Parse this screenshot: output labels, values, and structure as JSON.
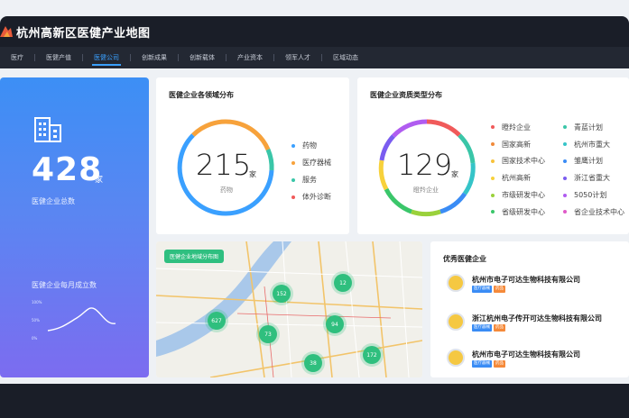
{
  "header": {
    "title": "杭州高新区医健产业地图"
  },
  "nav": [
    {
      "label": "医疗"
    },
    {
      "label": "医健产值"
    },
    {
      "label": "医健公司",
      "active": true
    },
    {
      "label": "创新成果"
    },
    {
      "label": "创新载体"
    },
    {
      "label": "产业资本"
    },
    {
      "label": "领军人才"
    },
    {
      "label": "区域动态"
    }
  ],
  "summary": {
    "total": "428",
    "unit": "家",
    "caption": "医健企业总数",
    "monthly_title": "医健企业每月成立数",
    "ticks": [
      "100%",
      "50%",
      "0%"
    ]
  },
  "field_dist": {
    "title": "医健企业各领域分布",
    "center_value": "215",
    "center_unit": "家",
    "center_label": "药物",
    "legend": [
      {
        "label": "药物",
        "color": "#3aa0ff"
      },
      {
        "label": "医疗器械",
        "color": "#f7a23b"
      },
      {
        "label": "服务",
        "color": "#3ac6a8"
      },
      {
        "label": "体外诊断",
        "color": "#f05a5a"
      }
    ]
  },
  "qual_dist": {
    "title": "医健企业资质类型分布",
    "center_value": "129",
    "center_unit": "家",
    "center_label": "瞪羚企业",
    "legend": [
      {
        "label": "瞪羚企业",
        "color": "#f05a5a"
      },
      {
        "label": "青蓝计划",
        "color": "#3ac6a8"
      },
      {
        "label": "国家高新",
        "color": "#f08a3a"
      },
      {
        "label": "杭州市重大",
        "color": "#35c4c8"
      },
      {
        "label": "国家技术中心",
        "color": "#f7c23b"
      },
      {
        "label": "雏鹰计划",
        "color": "#3a8cf5"
      },
      {
        "label": "杭州高新",
        "color": "#f7d13b"
      },
      {
        "label": "浙江省重大",
        "color": "#7a5cf0"
      },
      {
        "label": "市级研发中心",
        "color": "#9ad13b"
      },
      {
        "label": "5050计划",
        "color": "#b05cf0"
      },
      {
        "label": "省级研发中心",
        "color": "#3ac66a"
      },
      {
        "label": "省企业技术中心",
        "color": "#e05ac8"
      }
    ]
  },
  "map": {
    "label": "医健企业地域分布图",
    "bubbles": [
      "152",
      "12",
      "627",
      "94",
      "73",
      "38",
      "172"
    ]
  },
  "companies": {
    "title": "优秀医健企业",
    "items": [
      {
        "name": "杭州市电子可达生物科技有限公司",
        "tags": [
          "医疗器械",
          "药品"
        ]
      },
      {
        "name": "浙江杭州电子传开可达生物科技有限公司",
        "tags": [
          "医疗器械",
          "药品"
        ]
      },
      {
        "name": "杭州市电子可达生物科技有限公司",
        "tags": [
          "医疗器械",
          "药品"
        ]
      }
    ]
  }
}
